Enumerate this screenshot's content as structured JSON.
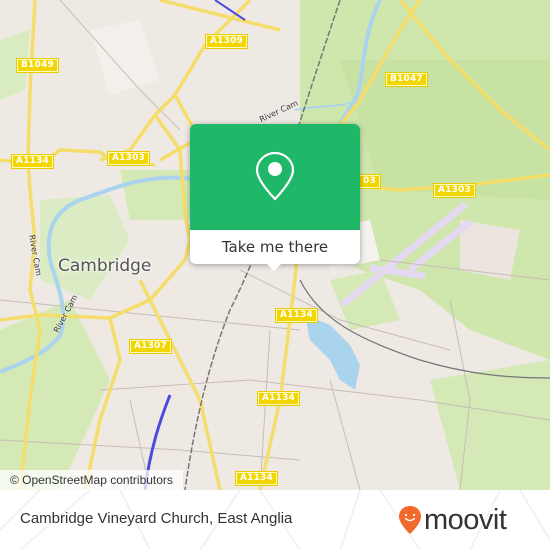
{
  "map": {
    "place_labels": [
      {
        "id": "cambridge",
        "text": "Cambridge"
      }
    ],
    "river_labels": [
      {
        "id": "river-cam-1",
        "text": "River Cam"
      },
      {
        "id": "river-cam-2",
        "text": "River Cam"
      },
      {
        "id": "river-cam-3",
        "text": "River Cam"
      }
    ],
    "road_labels": [
      {
        "id": "a1309",
        "text": "A1309"
      },
      {
        "id": "b1049",
        "text": "B1049"
      },
      {
        "id": "b1047",
        "text": "B1047"
      },
      {
        "id": "a1134-west",
        "text": "A1134"
      },
      {
        "id": "a1303-west",
        "text": "A1303"
      },
      {
        "id": "a1303-partial",
        "text": "03"
      },
      {
        "id": "a1303-east",
        "text": "A1303"
      },
      {
        "id": "a1134-mid",
        "text": "A1134"
      },
      {
        "id": "a1307",
        "text": "A1307"
      },
      {
        "id": "a1134-south",
        "text": "A1134"
      },
      {
        "id": "a1134-bottom",
        "text": "A1134"
      }
    ],
    "colors": {
      "land": "#efe9e4",
      "park": "#c8e2a4",
      "water": "#aad3ee",
      "road": "#f5dd6b",
      "road_label": "#f2d600",
      "runway": "#e3d9f0",
      "rail": "#777777",
      "transit": "#4b4be0"
    }
  },
  "popup": {
    "icon": "map-pin-icon",
    "button_label": "Take me there",
    "accent_color": "#1fb868"
  },
  "attribution": "© OpenStreetMap contributors",
  "footer": {
    "title": "Cambridge Vineyard Church, East Anglia",
    "logo_text": "moovit",
    "logo_icon": "moovit-smile-pin-icon",
    "logo_color": "#f26a2b"
  }
}
